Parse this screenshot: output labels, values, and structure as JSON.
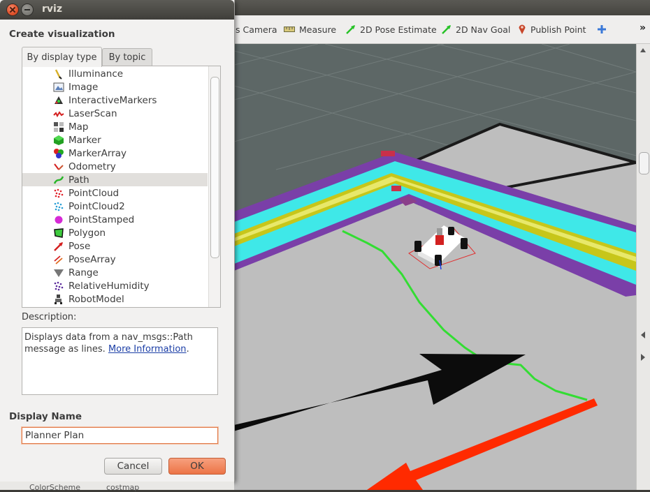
{
  "dialog": {
    "title": "rviz",
    "create_label": "Create visualization",
    "tabs": [
      {
        "label": "By display type"
      },
      {
        "label": "By topic"
      }
    ],
    "display_types": [
      {
        "label": "Illuminance",
        "icon": "illuminance-icon"
      },
      {
        "label": "Image",
        "icon": "image-icon"
      },
      {
        "label": "InteractiveMarkers",
        "icon": "interactive-markers-icon"
      },
      {
        "label": "LaserScan",
        "icon": "laserscan-icon"
      },
      {
        "label": "Map",
        "icon": "map-icon"
      },
      {
        "label": "Marker",
        "icon": "marker-icon"
      },
      {
        "label": "MarkerArray",
        "icon": "marker-array-icon"
      },
      {
        "label": "Odometry",
        "icon": "odometry-icon"
      },
      {
        "label": "Path",
        "icon": "path-icon",
        "selected": true
      },
      {
        "label": "PointCloud",
        "icon": "pointcloud-icon"
      },
      {
        "label": "PointCloud2",
        "icon": "pointcloud2-icon"
      },
      {
        "label": "PointStamped",
        "icon": "pointstamped-icon"
      },
      {
        "label": "Polygon",
        "icon": "polygon-icon"
      },
      {
        "label": "Pose",
        "icon": "pose-icon"
      },
      {
        "label": "PoseArray",
        "icon": "posearray-icon"
      },
      {
        "label": "Range",
        "icon": "range-icon"
      },
      {
        "label": "RelativeHumidity",
        "icon": "relative-humidity-icon"
      },
      {
        "label": "RobotModel",
        "icon": "robotmodel-icon"
      }
    ],
    "description_label": "Description:",
    "description_text": "Displays data from a nav_msgs::Path message as lines. ",
    "more_info_link": "More Information",
    "description_end": ".",
    "display_name_label": "Display Name",
    "display_name_value": "Planner Plan",
    "cancel_label": "Cancel",
    "ok_label": "OK"
  },
  "toolbar": {
    "camera_label": "s Camera",
    "measure_label": "Measure",
    "pose_estimate_label": "2D Pose Estimate",
    "nav_goal_label": "2D Nav Goal",
    "publish_point_label": "Publish Point",
    "overflow_label": "»"
  },
  "bottom_strip": {
    "left_text": "ColorScheme",
    "right_text": "costmap"
  },
  "colors": {
    "ok_button": "#ec7446",
    "selection": "#e1dfdc",
    "link": "#1b3ea6",
    "path_green": "#33dd33",
    "costmap_cyan": "#3fe8e8",
    "costmap_purple": "#7a3fa8",
    "costmap_yellow": "#c7c61a",
    "pose_red": "#ff2a00"
  }
}
